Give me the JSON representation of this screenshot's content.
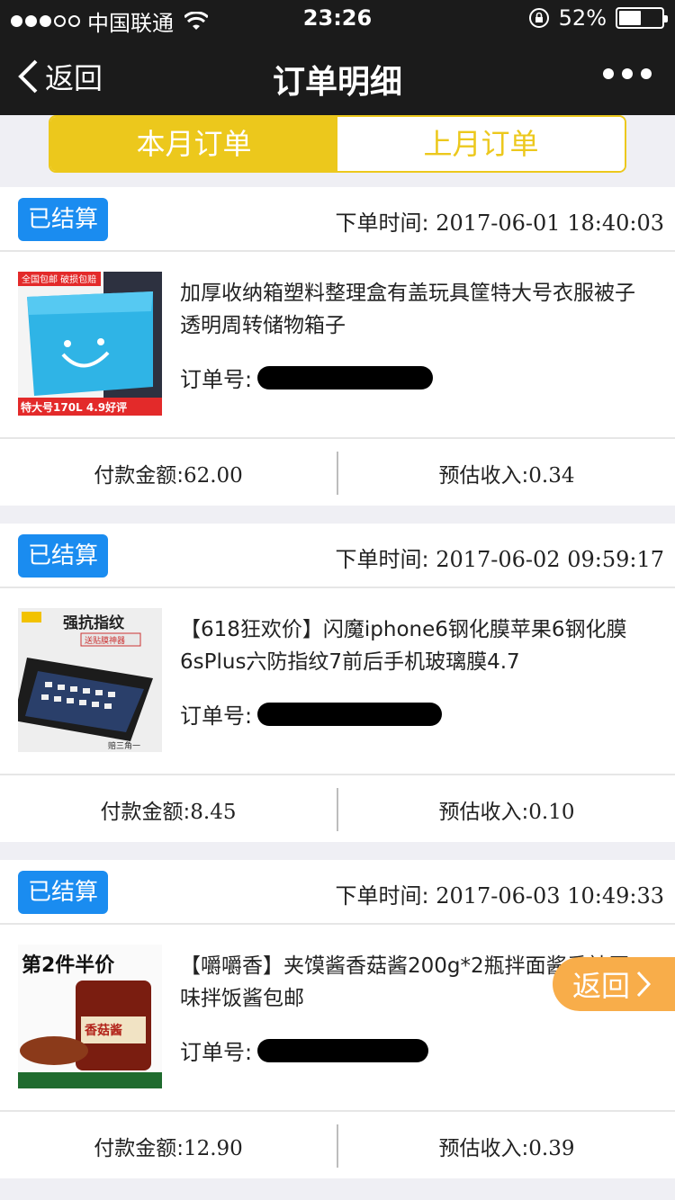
{
  "status": {
    "carrier": "中国联通",
    "time": "23:26",
    "battery": "52%",
    "battery_level": 0.52
  },
  "nav": {
    "back_label": "返回",
    "title": "订单明细"
  },
  "tabs": [
    {
      "label": "本月订单",
      "active": true
    },
    {
      "label": "上月订单",
      "active": false
    }
  ],
  "orders": [
    {
      "badge": "已结算",
      "time_label": "下单时间:",
      "time": "2017-06-01 18:40:03",
      "title": "加厚收纳箱塑料整理盒有盖玩具筐特大号衣服被子透明周转储物箱子",
      "order_label": "订单号:",
      "thumb_banner": "全国包邮 破损包赔",
      "thumb_caption": "特大号170L 4.9好评",
      "pay_label": "付款金额:",
      "pay": "62.00",
      "income_label": "预估收入:",
      "income": "0.34"
    },
    {
      "badge": "已结算",
      "time_label": "下单时间:",
      "time": "2017-06-02 09:59:17",
      "title": "【618狂欢价】闪魔iphone6钢化膜苹果6钢化膜6sPlus六防指纹7前后手机玻璃膜4.7",
      "order_label": "订单号:",
      "thumb_banner": "强抗指纹",
      "thumb_caption": "送贴膜神器",
      "thumb_caption2": "赔三角一",
      "pay_label": "付款金额:",
      "pay": "8.45",
      "income_label": "预估收入:",
      "income": "0.10"
    },
    {
      "badge": "已结算",
      "time_label": "下单时间:",
      "time": "2017-06-03 10:49:33",
      "title": "【嚼嚼香】夹馍酱香菇酱200g*2瓶拌面酱香辣原味拌饭酱包邮",
      "order_label": "订单号:",
      "thumb_banner": "第2件半价",
      "thumb_caption": "香菇酱",
      "pay_label": "付款金额:",
      "pay": "12.90",
      "income_label": "预估收入:",
      "income": "0.39"
    }
  ],
  "float_back": "返回",
  "colors": {
    "accent": "#ecc81c",
    "badge": "#1a8cf0",
    "float": "#f8ad4a",
    "bar": "#1b1b1b"
  }
}
